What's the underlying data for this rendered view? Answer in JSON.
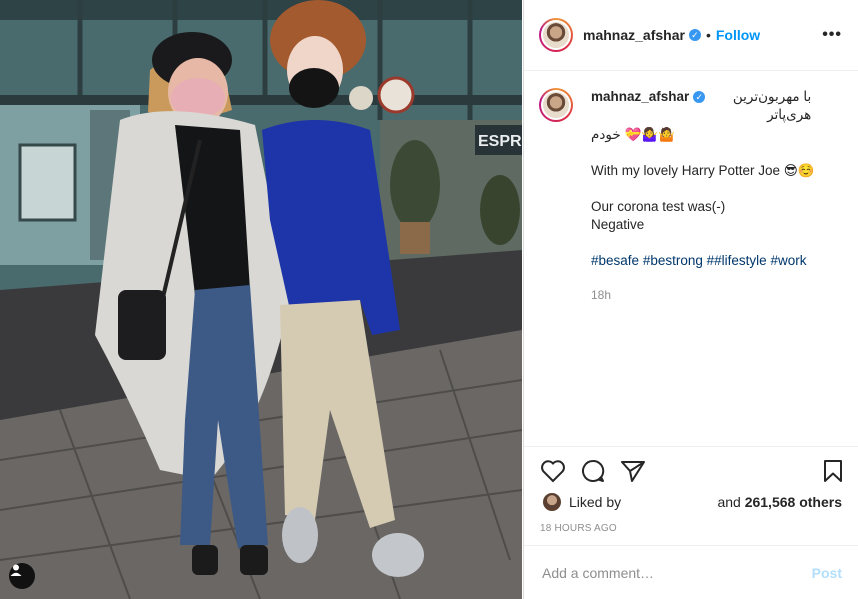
{
  "post": {
    "username": "mahnaz_afshar",
    "follow_label": "Follow",
    "more_label": "•••",
    "caption": {
      "persian_line1": "با مهربون‌ترین هری‌پاتر",
      "persian_line2": "خودم 💝🤷‍♀️🤷",
      "line1": "With my lovely Harry Potter Joe 😎☺️",
      "line2": "Our corona test was(-)",
      "line3": "Negative",
      "hashtags": [
        "#besafe",
        "#bestrong",
        "##lifestyle",
        "#work"
      ],
      "age": "18h"
    },
    "likes": {
      "liked_by_label": "Liked by",
      "and_label": "and",
      "others_label": "261,568 others"
    },
    "timestamp": "18 HOURS AGO",
    "comment_placeholder": "Add a comment…",
    "post_label": "Post",
    "photo_sign": "ESPR",
    "icons": {
      "verified": "verified-badge-icon",
      "like": "heart-icon",
      "comment": "comment-bubble-icon",
      "share": "paper-plane-icon",
      "save": "bookmark-icon",
      "tags": "user-tag-icon"
    },
    "colors": {
      "accent": "#0095f6",
      "verified": "#3897f0",
      "text": "#262626",
      "muted": "#8e8e8e"
    }
  }
}
